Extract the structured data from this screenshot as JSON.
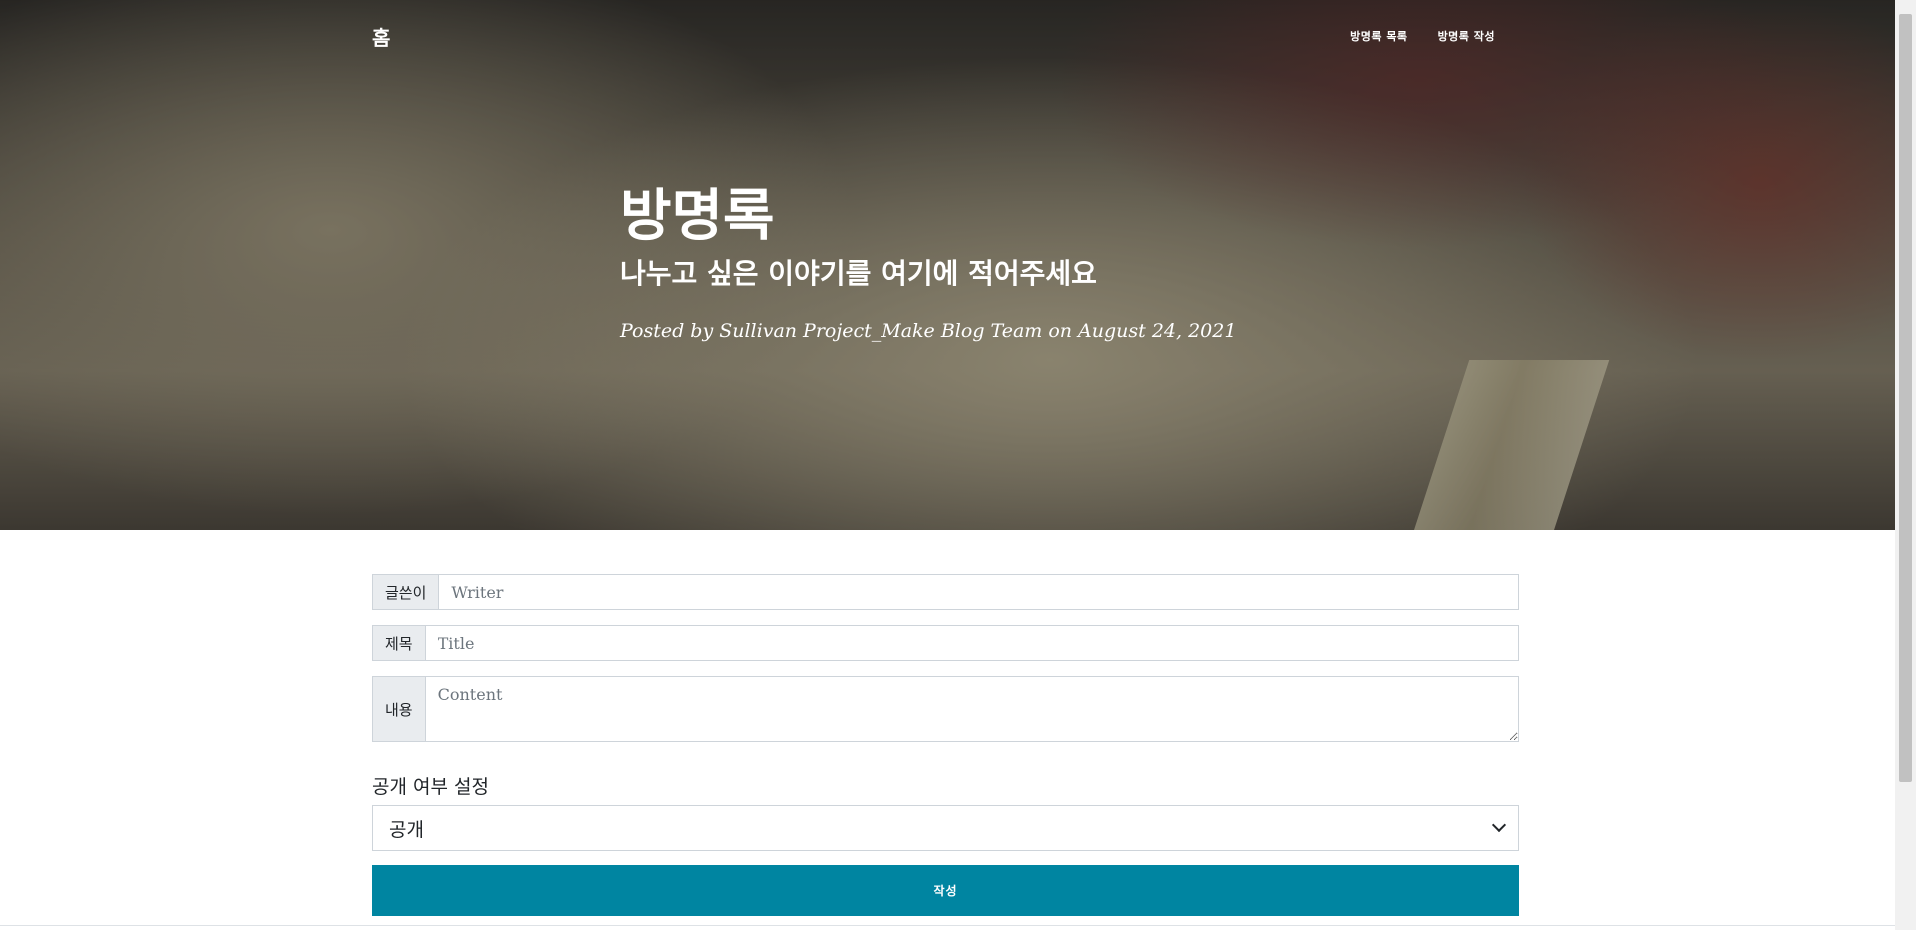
{
  "nav": {
    "brand": "홈",
    "links": [
      "방명록 목록",
      "방명록 작성"
    ]
  },
  "hero": {
    "title": "방명록",
    "subtitle": "나누고 싶은 이야기를 여기에 적어주세요",
    "meta": "Posted by Sullivan Project_Make Blog Team on August 24, 2021"
  },
  "form": {
    "writer": {
      "label": "글쓴이",
      "placeholder": "Writer",
      "value": ""
    },
    "title": {
      "label": "제목",
      "placeholder": "Title",
      "value": ""
    },
    "content": {
      "label": "내용",
      "placeholder": "Content",
      "value": ""
    },
    "visibility": {
      "label": "공개 여부 설정",
      "selected": "공개"
    },
    "submit_label": "작성"
  },
  "colors": {
    "accent": "#0085a1",
    "addon_bg": "#e9ecef",
    "border": "#ced4da"
  },
  "icons": {
    "select_arrow": "chevron-down-icon",
    "textarea_resize": "resize-handle-icon"
  }
}
